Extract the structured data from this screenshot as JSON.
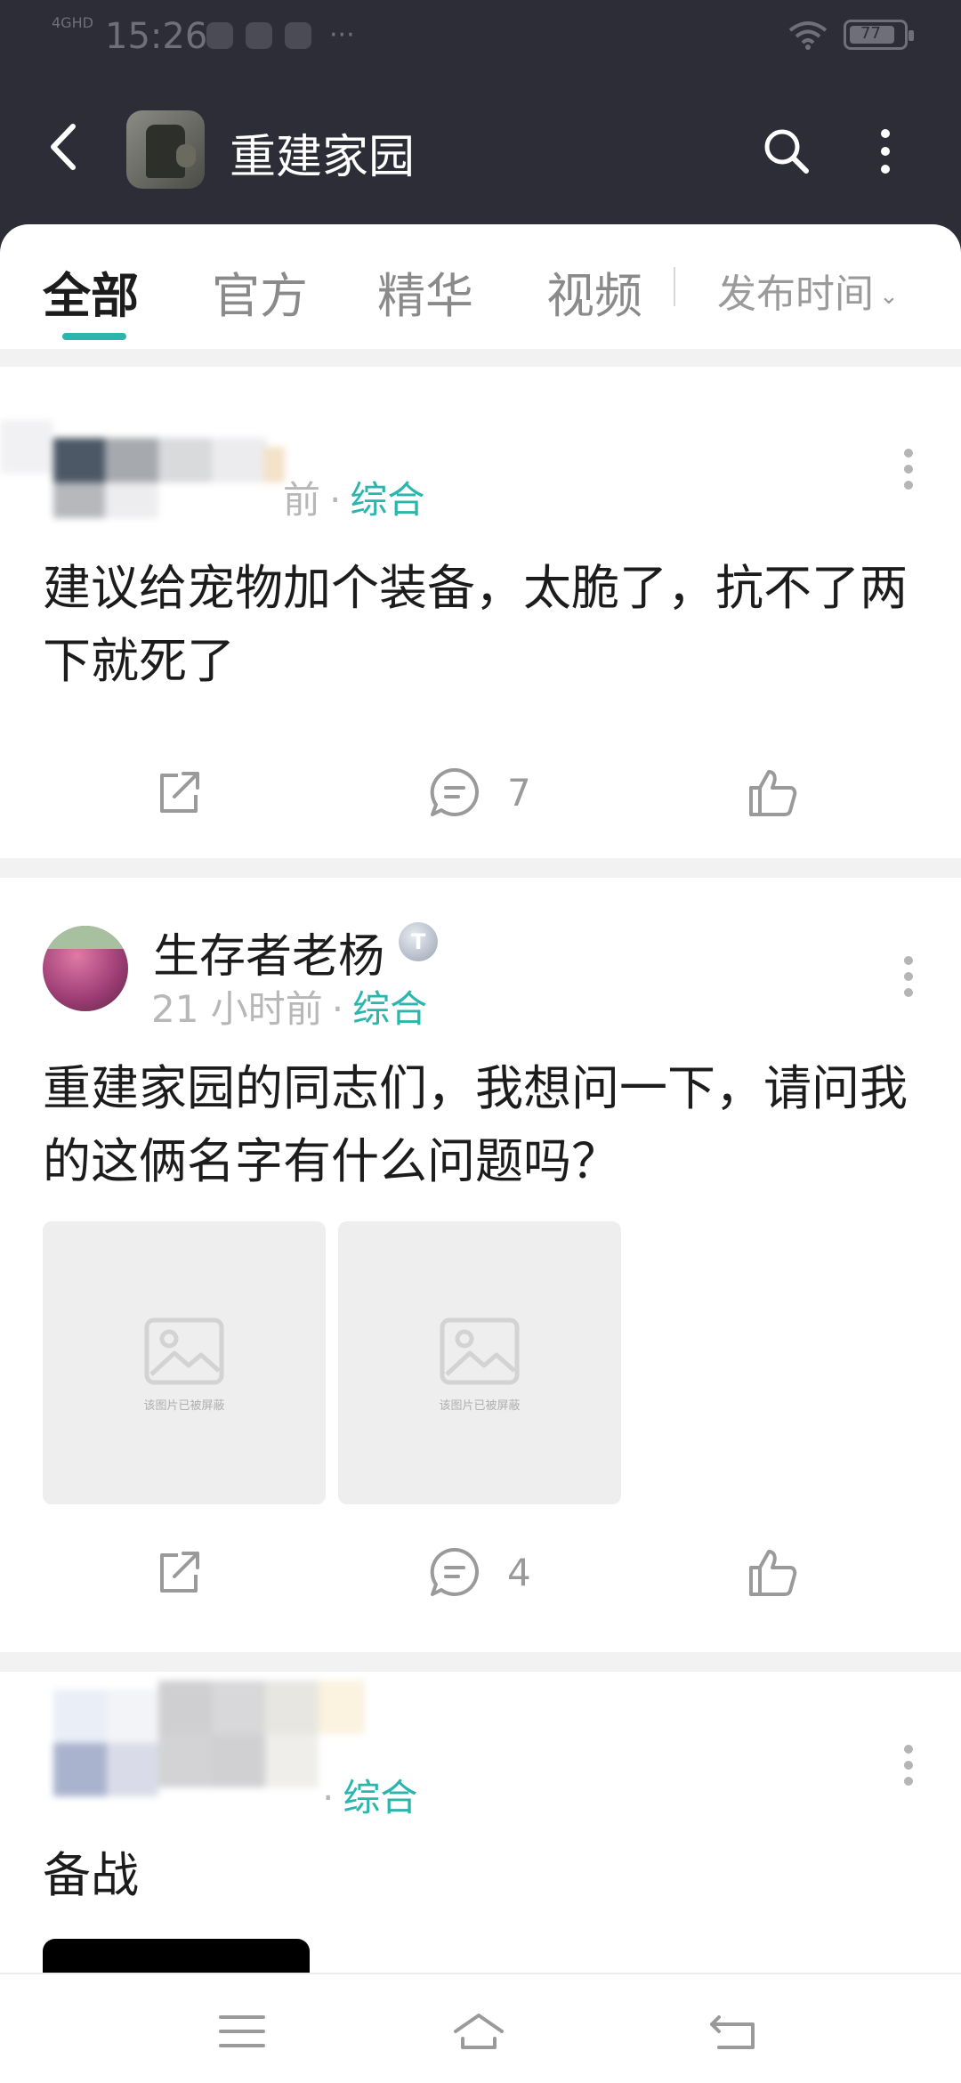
{
  "status_bar": {
    "time": "15:26",
    "network": "4GHD",
    "battery": "77"
  },
  "header": {
    "title": "重建家园",
    "back_icon": "back-arrow-icon",
    "search_icon": "search-icon",
    "more_icon": "more-vertical-icon"
  },
  "tabs": [
    {
      "label": "全部",
      "active": true
    },
    {
      "label": "官方",
      "active": false
    },
    {
      "label": "精华",
      "active": false
    },
    {
      "label": "视频",
      "active": false
    }
  ],
  "sort": {
    "label": "发布时间"
  },
  "posts": [
    {
      "time_partial": "前",
      "category": "综合",
      "text": "建议给宠物加个装备，太脆了，抗不了两下就死了",
      "comments": "7"
    },
    {
      "author": "生存者老杨",
      "badge": "T",
      "time": "21 小时前",
      "category": "综合",
      "text": "重建家园的同志们，我想问一下，请问我的这俩名字有什么问题吗？",
      "images": [
        {
          "caption": "该图片已被屏蔽"
        },
        {
          "caption": "该图片已被屏蔽"
        }
      ],
      "comments": "4"
    },
    {
      "category": "综合",
      "text": "备战"
    }
  ],
  "colors": {
    "accent": "#2bb5ad",
    "header_bg": "#2d2d37"
  }
}
